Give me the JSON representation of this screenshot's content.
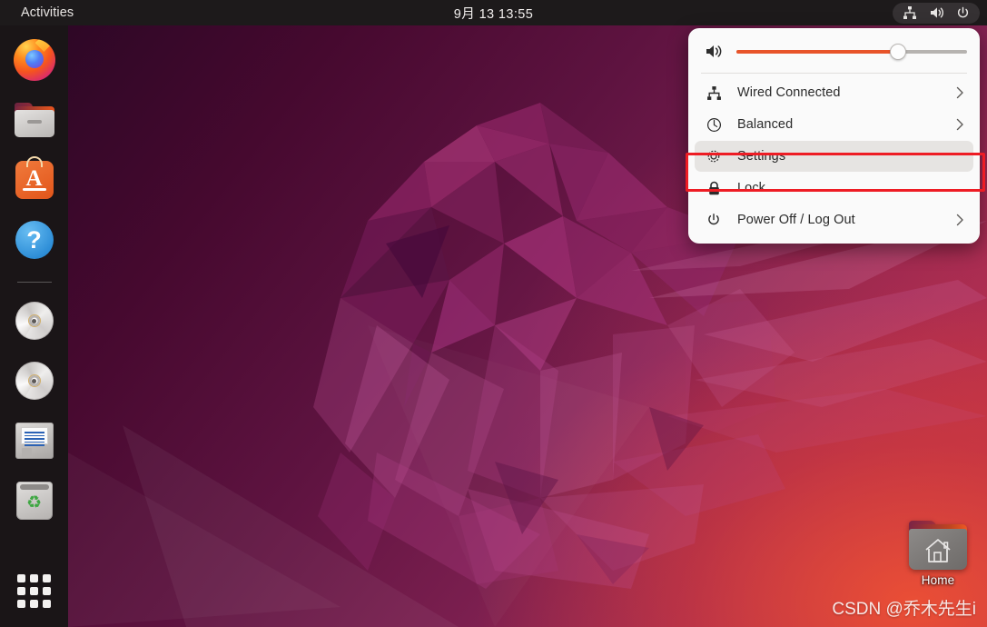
{
  "topbar": {
    "activities_label": "Activities",
    "clock": "9月 13  13:55",
    "status_icons": [
      "network-wired-icon",
      "volume-icon",
      "power-icon"
    ]
  },
  "dock": {
    "items": [
      {
        "name": "firefox",
        "label": "Firefox"
      },
      {
        "name": "files",
        "label": "Files"
      },
      {
        "name": "ubuntu-software",
        "label": "Ubuntu Software"
      },
      {
        "name": "help",
        "label": "Help"
      },
      {
        "name": "cd-drive-1",
        "label": "CD/DVD Drive"
      },
      {
        "name": "cd-drive-2",
        "label": "CD/DVD Drive"
      },
      {
        "name": "floppy-disk",
        "label": "Floppy Disk"
      },
      {
        "name": "trash",
        "label": "Trash"
      }
    ],
    "show_apps_label": "Show Applications"
  },
  "system_menu": {
    "volume": {
      "icon": "volume-high-icon",
      "percent": 70
    },
    "items": [
      {
        "icon": "network-wired-icon",
        "label": "Wired Connected",
        "has_submenu": true,
        "selected": false
      },
      {
        "icon": "speedometer-icon",
        "label": "Balanced",
        "has_submenu": true,
        "selected": false
      },
      {
        "icon": "gear-icon",
        "label": "Settings",
        "has_submenu": false,
        "selected": true
      },
      {
        "icon": "lock-icon",
        "label": "Lock",
        "has_submenu": false,
        "selected": false
      },
      {
        "icon": "power-icon",
        "label": "Power Off / Log Out",
        "has_submenu": true,
        "selected": false
      }
    ]
  },
  "desktop": {
    "home_icon_label": "Home",
    "watermark": "CSDN @乔木先生i"
  },
  "colors": {
    "accent_orange": "#e8542a",
    "annotation_red": "#ee1c24",
    "topbar_bg": "#1d1a1b",
    "menu_bg": "#fafafa",
    "menu_selected_bg": "#e6e4e2"
  }
}
